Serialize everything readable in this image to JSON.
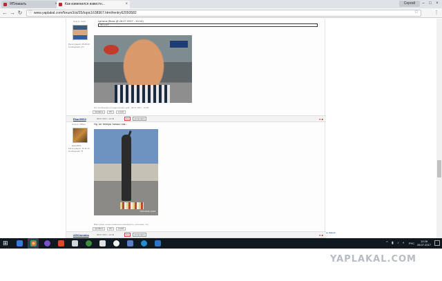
{
  "browser": {
    "tabs": [
      {
        "label": "ЯПлакалъ",
        "active": false
      },
      {
        "label": "Как изменился известн...",
        "active": true
      }
    ],
    "user_label": "Сергей",
    "url": "www.yaplakal.com/forum3/st/25/topic1638367.html#entry62093582"
  },
  "posts": [
    {
      "meta_top": "Статус: Gold",
      "meta_reg": "Регистрация: 25.08.10",
      "meta_posts": "Сообщений: 171",
      "quote_head": "Цитата (Boss @ 28.07.2017 - 10:14)",
      "quote_text": "Это кто?",
      "footer": "Это сообщение отредактировал geR - 28.07.2017 - 12:08",
      "actions": [
        "профиль",
        "ЛС",
        "в мой"
      ]
    },
    {
      "author": "Ekari0004",
      "date": "28.07.2017 - 12:02",
      "link1": "Ред",
      "link2": "цитировать",
      "status": "Статус: Offline",
      "rank": "Ekari0004",
      "meta_reg": "Регистрация: 12.11.14",
      "meta_posts": "Сообщений: 76",
      "text": "Ну, он теперь только так...",
      "watermark": "YAPLAKAL.COM",
      "footer": "Вам нужно лучше правильно переводить, учитывая, что...",
      "actions": [
        "профиль",
        "ЛС",
        "в мой"
      ]
    },
    {
      "author": "ASKtomaha",
      "date": "28.07.2017 - 12:02",
      "link1": "Ред",
      "link2": "цитировать"
    }
  ],
  "right_note": "▲ Наверх",
  "taskbar": {
    "language": "РУС",
    "time": "12:28",
    "date": "28.07.2017"
  },
  "watermark": "YAPLAKAL.COM"
}
